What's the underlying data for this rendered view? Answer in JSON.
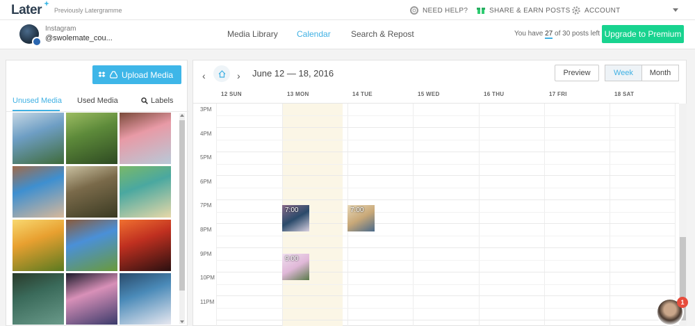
{
  "topbar": {
    "logo": "Later",
    "subtitle": "Previously Latergramme",
    "help": "NEED HELP?",
    "share": "SHARE & EARN POSTS",
    "account": "ACCOUNT"
  },
  "navbar": {
    "account_type": "Instagram",
    "account_name": "@swolemate_cou...",
    "links": [
      "Media Library",
      "Calendar",
      "Search & Repost"
    ],
    "posts_prefix": "You have",
    "posts_used": "27",
    "posts_suffix": "of 30 posts left",
    "upgrade": "Upgrade to Premium"
  },
  "media": {
    "upload": "Upload Media",
    "tabs": [
      "Unused Media",
      "Used Media",
      "Labels"
    ],
    "thumbnails": [
      {
        "colors": [
          "#6e9ec4",
          "#3f6b3a",
          "#c5d7e4"
        ]
      },
      {
        "colors": [
          "#5d8a3a",
          "#2e4a22",
          "#9cbc62"
        ]
      },
      {
        "colors": [
          "#e89aa6",
          "#b8c9d8",
          "#7a4a3a"
        ]
      },
      {
        "colors": [
          "#3e8fd0",
          "#d8b89a",
          "#a06a4a"
        ]
      },
      {
        "colors": [
          "#7a6a4a",
          "#3a3a22",
          "#c9c0a0"
        ]
      },
      {
        "colors": [
          "#4aa8a0",
          "#e8d8a8",
          "#7ab868"
        ]
      },
      {
        "colors": [
          "#e8a030",
          "#5a7a20",
          "#f8d870"
        ]
      },
      {
        "colors": [
          "#4a90d8",
          "#6a9a3a",
          "#8a5a3a"
        ]
      },
      {
        "colors": [
          "#c03020",
          "#2a1010",
          "#f07030"
        ]
      },
      {
        "colors": [
          "#3a6a5a",
          "#6a9a8a",
          "#2a3a2a"
        ]
      },
      {
        "colors": [
          "#d890b8",
          "#3a3a6a",
          "#1a1a2a"
        ]
      },
      {
        "colors": [
          "#4a8ab8",
          "#e8e8f0",
          "#2a4a6a"
        ]
      }
    ]
  },
  "calendar": {
    "date_range": "June 12 — 18, 2016",
    "preview": "Preview",
    "week": "Week",
    "month": "Month",
    "days": [
      "12 SUN",
      "13 MON",
      "14 TUE",
      "15 WED",
      "16 THU",
      "17 FRI",
      "18 SAT"
    ],
    "hours": [
      "3PM",
      "4PM",
      "5PM",
      "6PM",
      "7PM",
      "8PM",
      "9PM",
      "10PM",
      "11PM"
    ],
    "posts": [
      {
        "time": "7:00",
        "day": "13 MON",
        "colors": [
          "#2a4a6a",
          "#d8d0e0",
          "#8a6a8a"
        ]
      },
      {
        "time": "7:00",
        "day": "14 TUE",
        "colors": [
          "#c8a878",
          "#4a6a8a",
          "#e8d8b8"
        ]
      },
      {
        "time": "9:00",
        "day": "13 MON",
        "colors": [
          "#e0b8d8",
          "#5a7a4a",
          "#f0e0f0"
        ]
      }
    ]
  },
  "chat": {
    "badge": "1"
  }
}
